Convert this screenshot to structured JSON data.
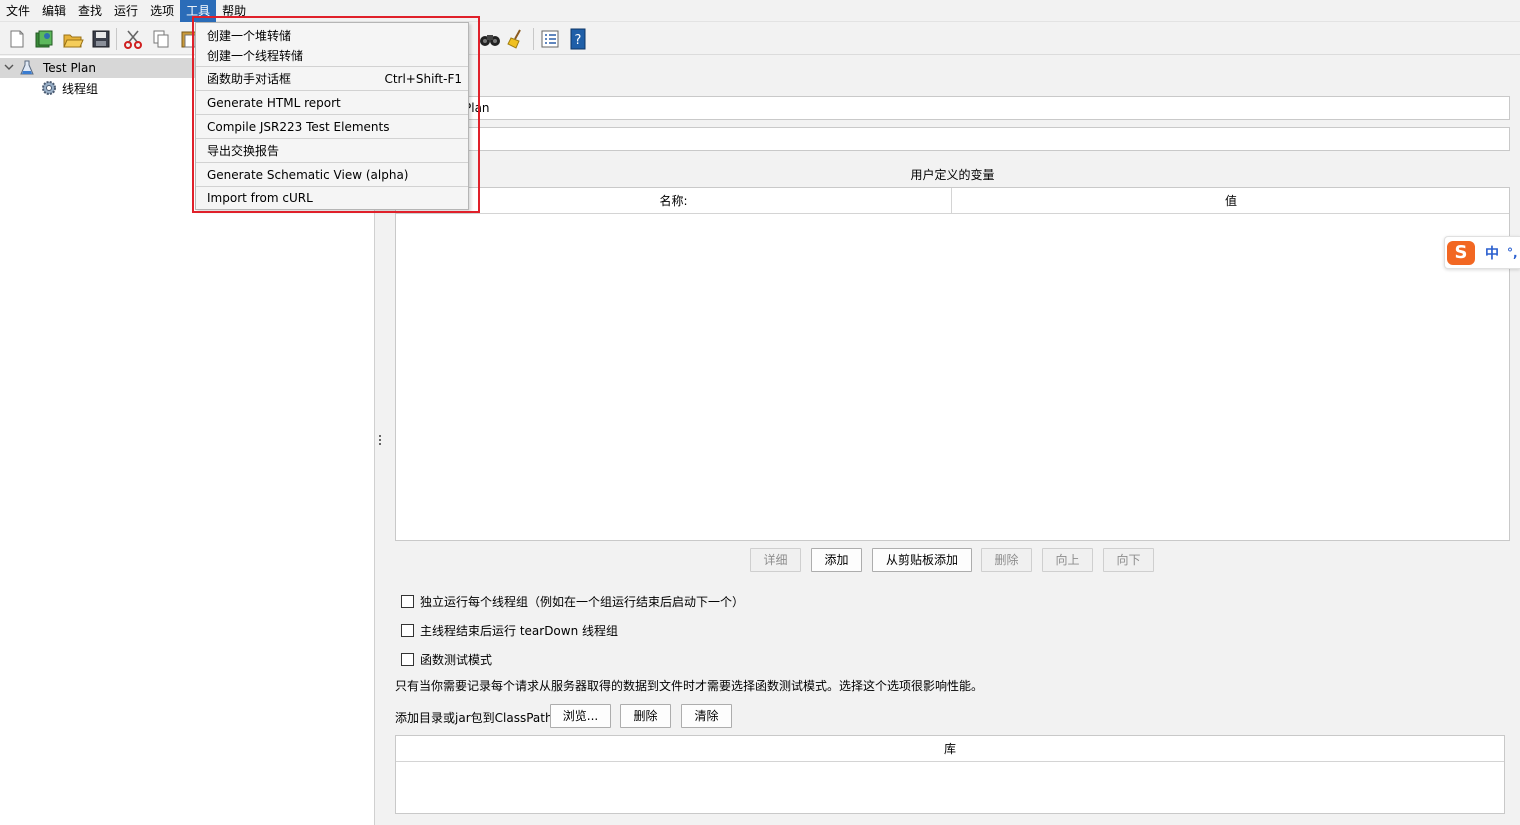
{
  "menubar": {
    "items": [
      "文件",
      "编辑",
      "查找",
      "运行",
      "选项",
      "工具",
      "帮助"
    ],
    "active_index": 5
  },
  "tree": {
    "root_label": "Test Plan",
    "child_label": "线程组"
  },
  "main": {
    "name_field_value": "Plan",
    "comment_field_value": "",
    "variables_title": "用户定义的变量",
    "var_columns": [
      "名称:",
      "值"
    ],
    "var_buttons": [
      "详细",
      "添加",
      "从剪贴板添加",
      "删除",
      "向上",
      "向下"
    ],
    "checkboxes": [
      {
        "label": "独立运行每个线程组（例如在一个组运行结束后启动下一个）",
        "checked": false
      },
      {
        "label": "主线程结束后运行 tearDown 线程组",
        "checked": false
      },
      {
        "label": "函数测试模式",
        "checked": false
      }
    ],
    "functional_note": "只有当你需要记录每个请求从服务器取得的数据到文件时才需要选择函数测试模式。选择这个选项很影响性能。",
    "classpath_label": "添加目录或jar包到ClassPath",
    "classpath_buttons": [
      "浏览...",
      "删除",
      "清除"
    ],
    "lib_column": "库"
  },
  "ime": {
    "logo": "S",
    "mode": "中",
    "punct": "°,"
  },
  "dropdown": {
    "items": [
      {
        "label": "创建一个堆转储",
        "shortcut": ""
      },
      {
        "label": "创建一个线程转储",
        "shortcut": ""
      },
      {
        "label": "函数助手对话框",
        "shortcut": "Ctrl+Shift-F1"
      },
      {
        "label": "Generate HTML report",
        "shortcut": ""
      },
      {
        "label": "Compile JSR223 Test Elements",
        "shortcut": ""
      },
      {
        "label": "导出交换报告",
        "shortcut": ""
      },
      {
        "label": "Generate Schematic View (alpha)",
        "shortcut": ""
      },
      {
        "label": "Import from cURL",
        "shortcut": ""
      }
    ]
  },
  "colors": {
    "highlight": "#e0202a",
    "menu_active": "#2b6cb8"
  }
}
